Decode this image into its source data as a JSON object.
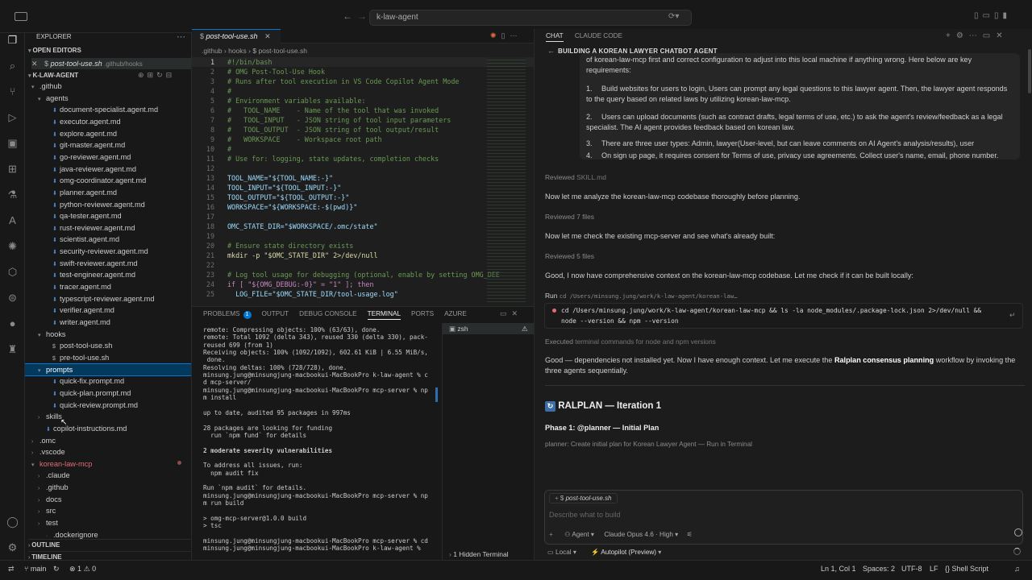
{
  "titlebar": {
    "search": "k-law-agent"
  },
  "explorer": {
    "header": "EXPLORER",
    "open_editors": "OPEN EDITORS",
    "open_file": "post-tool-use.sh",
    "open_file_path": ".github/hooks",
    "workspace": "K-LAW-AGENT",
    "rows": [
      {
        "label": ".github",
        "indent": 1,
        "open": true,
        "color": "#cccccc"
      },
      {
        "label": "agents",
        "indent": 2,
        "open": true,
        "color": "#cccccc"
      },
      {
        "label": "document-specialist.agent.md",
        "indent": 3,
        "color": "#cccccc"
      },
      {
        "label": "executor.agent.md",
        "indent": 3,
        "color": "#cccccc"
      },
      {
        "label": "explore.agent.md",
        "indent": 3,
        "color": "#cccccc"
      },
      {
        "label": "git-master.agent.md",
        "indent": 3,
        "color": "#cccccc"
      },
      {
        "label": "go-reviewer.agent.md",
        "indent": 3,
        "color": "#cccccc"
      },
      {
        "label": "java-reviewer.agent.md",
        "indent": 3,
        "color": "#cccccc"
      },
      {
        "label": "omg-coordinator.agent.md",
        "indent": 3,
        "color": "#cccccc"
      },
      {
        "label": "planner.agent.md",
        "indent": 3,
        "color": "#cccccc"
      },
      {
        "label": "python-reviewer.agent.md",
        "indent": 3,
        "color": "#cccccc"
      },
      {
        "label": "qa-tester.agent.md",
        "indent": 3,
        "color": "#cccccc"
      },
      {
        "label": "rust-reviewer.agent.md",
        "indent": 3,
        "color": "#cccccc"
      },
      {
        "label": "scientist.agent.md",
        "indent": 3,
        "color": "#cccccc"
      },
      {
        "label": "security-reviewer.agent.md",
        "indent": 3,
        "color": "#cccccc"
      },
      {
        "label": "swift-reviewer.agent.md",
        "indent": 3,
        "color": "#cccccc"
      },
      {
        "label": "test-engineer.agent.md",
        "indent": 3,
        "color": "#cccccc"
      },
      {
        "label": "tracer.agent.md",
        "indent": 3,
        "color": "#cccccc"
      },
      {
        "label": "typescript-reviewer.agent.md",
        "indent": 3,
        "color": "#cccccc"
      },
      {
        "label": "verifier.agent.md",
        "indent": 3,
        "color": "#cccccc"
      },
      {
        "label": "writer.agent.md",
        "indent": 3,
        "color": "#cccccc"
      },
      {
        "label": "hooks",
        "indent": 2,
        "open": true,
        "color": "#cccccc"
      },
      {
        "label": "post-tool-use.sh",
        "indent": 3,
        "color": "#cccccc"
      },
      {
        "label": "pre-tool-use.sh",
        "indent": 3,
        "color": "#cccccc"
      },
      {
        "label": "prompts",
        "indent": 2,
        "open": true,
        "color": "#ffffff",
        "selected": true
      },
      {
        "label": "quick-fix.prompt.md",
        "indent": 3,
        "color": "#cccccc"
      },
      {
        "label": "quick-plan.prompt.md",
        "indent": 3,
        "color": "#cccccc"
      },
      {
        "label": "quick-review.prompt.md",
        "indent": 3,
        "color": "#cccccc"
      },
      {
        "label": "skills",
        "indent": 2,
        "open": false,
        "color": "#cccccc"
      },
      {
        "label": "copilot-instructions.md",
        "indent": 2,
        "color": "#cccccc"
      },
      {
        "label": ".omc",
        "indent": 1,
        "open": false,
        "color": "#cccccc"
      },
      {
        "label": ".vscode",
        "indent": 1,
        "open": false,
        "color": "#cccccc"
      },
      {
        "label": "korean-law-mcp",
        "indent": 1,
        "open": true,
        "color": "#e06c75"
      },
      {
        "label": ".claude",
        "indent": 2,
        "open": false,
        "color": "#cccccc"
      },
      {
        "label": ".github",
        "indent": 2,
        "open": false,
        "color": "#cccccc"
      },
      {
        "label": "docs",
        "indent": 2,
        "open": false,
        "color": "#cccccc"
      },
      {
        "label": "src",
        "indent": 2,
        "open": false,
        "color": "#cccccc"
      },
      {
        "label": "test",
        "indent": 2,
        "open": false,
        "color": "#cccccc"
      },
      {
        "label": ".dockerignore",
        "indent": 2,
        "color": "#cccccc"
      }
    ],
    "outline": "OUTLINE",
    "timeline": "TIMELINE"
  },
  "editor": {
    "tab": "post-tool-use.sh",
    "breadcrumb": [
      ".github",
      "hooks",
      "post-tool-use.sh"
    ],
    "lines": [
      {
        "n": "1",
        "t": "#!/bin/bash",
        "c": "cm"
      },
      {
        "n": "2",
        "t": "# OMG Post-Tool-Use Hook",
        "c": "cm"
      },
      {
        "n": "3",
        "t": "# Runs after tool execution in VS Code Copilot Agent Mode",
        "c": "cm"
      },
      {
        "n": "4",
        "t": "#",
        "c": "cm"
      },
      {
        "n": "5",
        "t": "# Environment variables available:",
        "c": "cm"
      },
      {
        "n": "6",
        "t": "#   TOOL_NAME    - Name of the tool that was invoked",
        "c": "cm"
      },
      {
        "n": "7",
        "t": "#   TOOL_INPUT   - JSON string of tool input parameters",
        "c": "cm"
      },
      {
        "n": "8",
        "t": "#   TOOL_OUTPUT  - JSON string of tool output/result",
        "c": "cm"
      },
      {
        "n": "9",
        "t": "#   WORKSPACE    - Workspace root path",
        "c": "cm"
      },
      {
        "n": "10",
        "t": "#",
        "c": "cm"
      },
      {
        "n": "11",
        "t": "# Use for: logging, state updates, completion checks",
        "c": "cm"
      },
      {
        "n": "12",
        "t": "",
        "c": ""
      },
      {
        "n": "13",
        "t": "TOOL_NAME=\"${TOOL_NAME:-}\"",
        "c": "var"
      },
      {
        "n": "14",
        "t": "TOOL_INPUT=\"${TOOL_INPUT:-}\"",
        "c": "var"
      },
      {
        "n": "15",
        "t": "TOOL_OUTPUT=\"${TOOL_OUTPUT:-}\"",
        "c": "var"
      },
      {
        "n": "16",
        "t": "WORKSPACE=\"${WORKSPACE:-$(pwd)}\"",
        "c": "var"
      },
      {
        "n": "17",
        "t": "",
        "c": ""
      },
      {
        "n": "18",
        "t": "OMC_STATE_DIR=\"$WORKSPACE/.omc/state\"",
        "c": "var"
      },
      {
        "n": "19",
        "t": "",
        "c": ""
      },
      {
        "n": "20",
        "t": "# Ensure state directory exists",
        "c": "cm"
      },
      {
        "n": "21",
        "t": "mkdir -p \"$OMC_STATE_DIR\" 2>/dev/null",
        "c": "fn"
      },
      {
        "n": "22",
        "t": "",
        "c": ""
      },
      {
        "n": "23",
        "t": "# Log tool usage for debugging (optional, enable by setting OMG_DEE",
        "c": "cm"
      },
      {
        "n": "24",
        "t": "if [ \"${OMG_DEBUG:-0}\" = \"1\" ]; then",
        "c": "kw"
      },
      {
        "n": "25",
        "t": "  LOG_FILE=\"$OMC_STATE_DIR/tool-usage.log\"",
        "c": "var"
      }
    ]
  },
  "panel": {
    "tabs": [
      "PROBLEMS",
      "OUTPUT",
      "DEBUG CONSOLE",
      "TERMINAL",
      "PORTS",
      "AZURE"
    ],
    "problems_count": "1",
    "active_tab": "TERMINAL",
    "terminal_lines": [
      "remote: Compressing objects: 100% (63/63), done.",
      "remote: Total 1092 (delta 343), reused 330 (delta 330), pack-",
      "reused 699 (from 1)",
      "Receiving objects: 100% (1092/1092), 602.61 KiB | 6.55 MiB/s,",
      " done.",
      "Resolving deltas: 100% (728/728), done.",
      "minsung.jung@minsungjung-macbookui-MacBookPro k-law-agent % c",
      "d mcp-server/",
      "minsung.jung@minsungjung-macbookui-MacBookPro mcp-server % np",
      "m install",
      "",
      "up to date, audited 95 packages in 997ms",
      "",
      "28 packages are looking for funding",
      "  run `npm fund` for details",
      "",
      "2 moderate severity vulnerabilities",
      "",
      "To address all issues, run:",
      "  npm audit fix",
      "",
      "Run `npm audit` for details.",
      "minsung.jung@minsungjung-macbookui-MacBookPro mcp-server % np",
      "m run build",
      "",
      "> omg-mcp-server@1.0.0 build",
      "> tsc",
      "",
      "minsung.jung@minsungjung-macbookui-MacBookPro mcp-server % cd",
      "minsung.jung@minsungjung-macbookui-MacBookPro k-law-agent % "
    ],
    "shell": "zsh",
    "hidden_terminal": "1 Hidden Terminal"
  },
  "chat": {
    "tabs": [
      "CHAT",
      "CLAUDE CODE"
    ],
    "title": "BUILDING A KOREAN LAWYER CHATBOT AGENT",
    "req_intro": "of korean-law-mcp first and correct configuration to adjust into this local machine if anything wrong. Here below are key requirements:",
    "requirements": [
      "Build websites for users to login, Users can prompt any legal questions to this lawyer agent. Then, the lawyer agent responds to the query based on related laws by utilizing korean-law-mcp.",
      "Users can upload documents (such as contract drafts, legal terms of use, etc.) to ask the agent's review/feedback as a legal specialist. The AI agent provides feedback based on korean law.",
      "There are three user types: Admin, lawyer(User-level, but can leave comments on AI Agent's analysis/results), user",
      "On sign up page, it requires consent for Terms of use, privacy use agreements. Collect user's name, email, phone number."
    ],
    "reviewed1": "Reviewed",
    "reviewed1_file": "SKILL.md",
    "msg1": "Now let me analyze the korean-law-mcp codebase thoroughly before planning.",
    "reviewed2": "Reviewed 7 files",
    "msg2": "Now let me check the existing mcp-server and see what's already built:",
    "reviewed3": "Reviewed 5 files",
    "msg3": "Good, I now have comprehensive context on the korean-law-mcp codebase. Let me check if it can be built locally:",
    "run_label": "Run",
    "run_cmd_short": "cd /Users/minsung.jung/work/k-law-agent/korean-law…",
    "run_cmd_1": "cd /Users/minsung.jung/work/k-law-agent/korean-law-mcp && ls -la node_modules/.package-lock.json 2>/dev/null &&",
    "run_cmd_2": "node --version && npm --version",
    "executed": "Executed",
    "executed_rest": "terminal commands for node and npm versions",
    "msg4_a": "Good — dependencies not installed yet. Now I have enough context. Let me execute the",
    "msg4_bold": "Ralplan consensus planning",
    "msg4_b": "workflow by invoking the",
    "msg4_c": "three agents sequentially.",
    "heading": "RALPLAN — Iteration 1",
    "phase": "Phase 1: @planner — Initial Plan",
    "planner_line": "planner: Create initial plan for Korean Lawyer Agent — Run in Terminal",
    "input_file": "post-tool-use.sh",
    "input_placeholder": "Describe what to build",
    "agent": "Agent",
    "model": "Claude Opus 4.6 · High",
    "local": "Local",
    "autopilot": "Autopilot (Preview)"
  },
  "status": {
    "branch": "main",
    "errors": "1",
    "warnings": "0",
    "position": "Ln 1, Col 1",
    "spaces": "Spaces: 2",
    "encoding": "UTF-8",
    "eol": "LF",
    "language": "Shell Script"
  },
  "colors": {
    "accent": "#0078d4",
    "selected": "#04395e",
    "korean": "#e06c75",
    "autopilot": "#f0a030"
  }
}
